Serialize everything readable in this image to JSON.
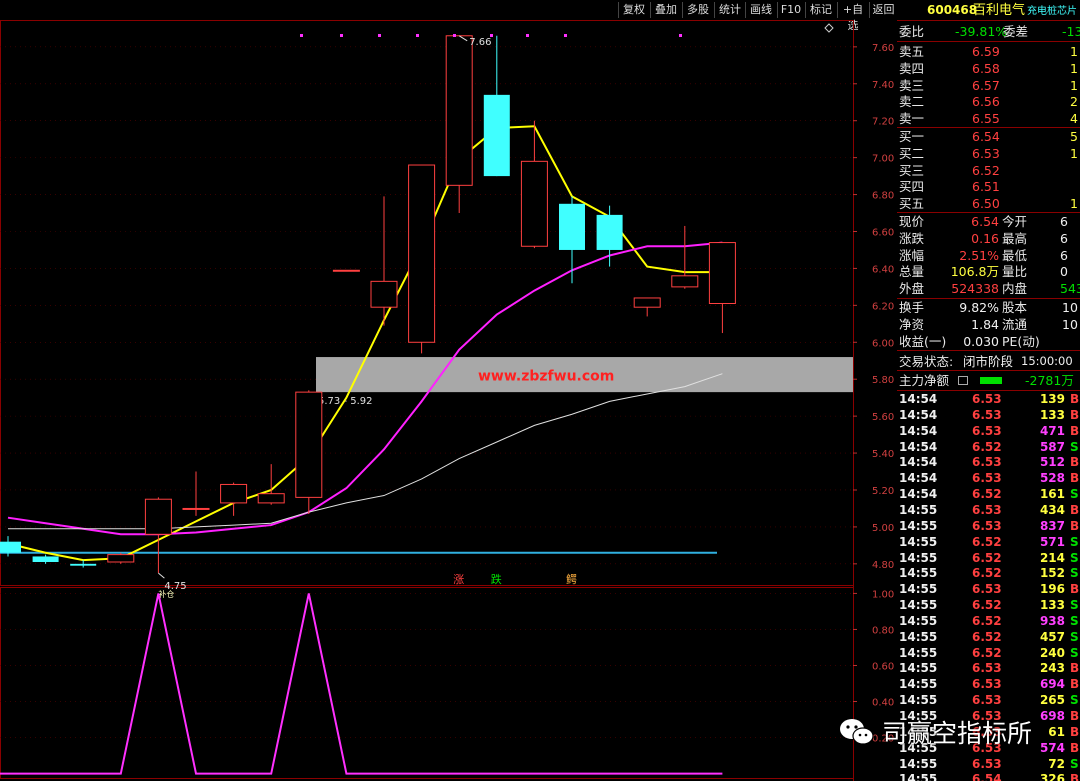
{
  "toolbar": {
    "buttons": [
      "复权",
      "叠加",
      "多股",
      "统计",
      "画线",
      "F10",
      "标记",
      "+自选",
      "返回"
    ]
  },
  "stock": {
    "code": "600468",
    "name": "百利电气",
    "tag": "充电桩芯片"
  },
  "quote": {
    "weibi_label": "委比",
    "weibi_value": "-39.81%",
    "weicha_label": "委差",
    "weicha_value": "-13",
    "asks": [
      {
        "label": "卖五",
        "price": "6.59",
        "vol": "1"
      },
      {
        "label": "卖四",
        "price": "6.58",
        "vol": "1"
      },
      {
        "label": "卖三",
        "price": "6.57",
        "vol": "1"
      },
      {
        "label": "卖二",
        "price": "6.56",
        "vol": "2"
      },
      {
        "label": "卖一",
        "price": "6.55",
        "vol": "4"
      }
    ],
    "bids": [
      {
        "label": "买一",
        "price": "6.54",
        "vol": "5"
      },
      {
        "label": "买二",
        "price": "6.53",
        "vol": "1"
      },
      {
        "label": "买三",
        "price": "6.52",
        "vol": ""
      },
      {
        "label": "买四",
        "price": "6.51",
        "vol": ""
      },
      {
        "label": "买五",
        "price": "6.50",
        "vol": "1"
      }
    ],
    "stats": [
      {
        "l1": "现价",
        "v1": "6.54",
        "l2": "今开",
        "v2": "6"
      },
      {
        "l1": "涨跌",
        "v1": "0.16",
        "l2": "最高",
        "v2": "6"
      },
      {
        "l1": "涨幅",
        "v1": "2.51%",
        "l2": "最低",
        "v2": "6"
      },
      {
        "l1": "总量",
        "v1": "106.8万",
        "l2": "量比",
        "v2": "0"
      },
      {
        "l1": "外盘",
        "v1": "524338",
        "l2": "内盘",
        "v2": "543"
      }
    ],
    "stats2": [
      {
        "l1": "换手",
        "v1": "9.82%",
        "l2": "股本",
        "v2": "10"
      },
      {
        "l1": "净资",
        "v1": "1.84",
        "l2": "流通",
        "v2": "10"
      },
      {
        "l1": "收益(一)",
        "v1": "0.030",
        "l2": "PE(动)",
        "v2": ""
      }
    ],
    "trade_state_label": "交易状态:",
    "trade_state_value": "闭市阶段",
    "trade_time": "15:00:00",
    "main_force_label": "主力净额",
    "main_force_value": "-2781万"
  },
  "ticks": [
    {
      "t": "14:54",
      "p": "6.53",
      "v": "139",
      "d": "B",
      "vc": "yel"
    },
    {
      "t": "14:54",
      "p": "6.53",
      "v": "133",
      "d": "B",
      "vc": "yel"
    },
    {
      "t": "14:54",
      "p": "6.53",
      "v": "471",
      "d": "B",
      "vc": "mag"
    },
    {
      "t": "14:54",
      "p": "6.52",
      "v": "587",
      "d": "S",
      "vc": "mag"
    },
    {
      "t": "14:54",
      "p": "6.53",
      "v": "512",
      "d": "B",
      "vc": "mag"
    },
    {
      "t": "14:54",
      "p": "6.53",
      "v": "528",
      "d": "B",
      "vc": "mag"
    },
    {
      "t": "14:54",
      "p": "6.52",
      "v": "161",
      "d": "S",
      "vc": "yel"
    },
    {
      "t": "14:55",
      "p": "6.53",
      "v": "434",
      "d": "B",
      "vc": "yel"
    },
    {
      "t": "14:55",
      "p": "6.53",
      "v": "837",
      "d": "B",
      "vc": "mag"
    },
    {
      "t": "14:55",
      "p": "6.52",
      "v": "571",
      "d": "S",
      "vc": "mag"
    },
    {
      "t": "14:55",
      "p": "6.52",
      "v": "214",
      "d": "S",
      "vc": "yel"
    },
    {
      "t": "14:55",
      "p": "6.52",
      "v": "152",
      "d": "S",
      "vc": "yel"
    },
    {
      "t": "14:55",
      "p": "6.53",
      "v": "196",
      "d": "B",
      "vc": "yel"
    },
    {
      "t": "14:55",
      "p": "6.52",
      "v": "133",
      "d": "S",
      "vc": "yel"
    },
    {
      "t": "14:55",
      "p": "6.52",
      "v": "938",
      "d": "S",
      "vc": "mag"
    },
    {
      "t": "14:55",
      "p": "6.52",
      "v": "457",
      "d": "S",
      "vc": "yel"
    },
    {
      "t": "14:55",
      "p": "6.52",
      "v": "240",
      "d": "S",
      "vc": "yel"
    },
    {
      "t": "14:55",
      "p": "6.53",
      "v": "243",
      "d": "B",
      "vc": "yel"
    },
    {
      "t": "14:55",
      "p": "6.53",
      "v": "694",
      "d": "B",
      "vc": "mag"
    },
    {
      "t": "14:55",
      "p": "6.53",
      "v": "265",
      "d": "S",
      "vc": "yel"
    },
    {
      "t": "14:55",
      "p": "6.53",
      "v": "698",
      "d": "B",
      "vc": "mag"
    },
    {
      "t": "14:55",
      "p": "6.53",
      "v": "61",
      "d": "B",
      "vc": "yel"
    },
    {
      "t": "14:55",
      "p": "6.53",
      "v": "574",
      "d": "B",
      "vc": "mag"
    },
    {
      "t": "14:55",
      "p": "6.53",
      "v": "72",
      "d": "S",
      "vc": "yel"
    },
    {
      "t": "14:55",
      "p": "6.54",
      "v": "326",
      "d": "B",
      "vc": "yel"
    }
  ],
  "chart_data": [
    {
      "type": "candlestick",
      "y_ticks": [
        7.6,
        7.4,
        7.2,
        7.0,
        6.8,
        6.6,
        6.4,
        6.2,
        6.0,
        5.8,
        5.6,
        5.4,
        5.2,
        5.0,
        4.8
      ],
      "ylim": [
        4.68,
        7.74
      ],
      "candles": [
        {
          "o": 4.92,
          "c": 4.86,
          "h": 4.95,
          "l": 4.84
        },
        {
          "o": 4.84,
          "c": 4.81,
          "h": 4.85,
          "l": 4.8
        },
        {
          "o": 4.8,
          "c": 4.79,
          "h": 4.82,
          "l": 4.78
        },
        {
          "o": 4.81,
          "c": 4.85,
          "h": 4.86,
          "l": 4.8
        },
        {
          "o": 4.96,
          "c": 5.15,
          "h": 5.16,
          "l": 4.75
        },
        {
          "o": 5.1,
          "c": 5.1,
          "h": 5.3,
          "l": 5.06
        },
        {
          "o": 5.13,
          "c": 5.23,
          "h": 5.24,
          "l": 5.06
        },
        {
          "o": 5.13,
          "c": 5.18,
          "h": 5.34,
          "l": 5.12
        },
        {
          "o": 5.16,
          "c": 5.73,
          "h": 5.74,
          "l": 5.07
        },
        {
          "o": 6.39,
          "c": 6.39,
          "h": 6.39,
          "l": 6.39
        },
        {
          "o": 6.19,
          "c": 6.33,
          "h": 6.79,
          "l": 6.09
        },
        {
          "o": 6.0,
          "c": 6.96,
          "h": 6.96,
          "l": 5.94
        },
        {
          "o": 6.85,
          "c": 7.66,
          "h": 7.66,
          "l": 6.7
        },
        {
          "o": 7.34,
          "c": 6.9,
          "h": 7.66,
          "l": 6.9
        },
        {
          "o": 6.52,
          "c": 6.98,
          "h": 7.2,
          "l": 6.51
        },
        {
          "o": 6.75,
          "c": 6.5,
          "h": 6.79,
          "l": 6.32
        },
        {
          "o": 6.69,
          "c": 6.5,
          "h": 6.74,
          "l": 6.41
        },
        {
          "o": 6.19,
          "c": 6.24,
          "h": 6.24,
          "l": 6.14
        },
        {
          "o": 6.3,
          "c": 6.36,
          "h": 6.63,
          "l": 6.29
        },
        {
          "o": 6.21,
          "c": 6.54,
          "h": 6.54,
          "l": 6.05
        }
      ],
      "series": [
        {
          "color": "#ffff00",
          "values": [
            4.91,
            4.86,
            4.82,
            4.83,
            4.93,
            5.03,
            5.13,
            5.2,
            5.38,
            5.7,
            6.12,
            6.52,
            6.99,
            7.16,
            7.17,
            6.79,
            6.68,
            6.41,
            6.38,
            6.38
          ]
        },
        {
          "color": "#ff20ff",
          "values": [
            5.05,
            5.02,
            4.99,
            4.96,
            4.96,
            4.97,
            4.99,
            5.01,
            5.08,
            5.21,
            5.42,
            5.68,
            5.96,
            6.15,
            6.28,
            6.39,
            6.47,
            6.52,
            6.52,
            6.54
          ]
        },
        {
          "color": "#e0e0e0",
          "values": [
            4.99,
            4.99,
            4.99,
            4.99,
            4.99,
            5.0,
            5.01,
            5.02,
            5.08,
            5.13,
            5.17,
            5.26,
            5.37,
            5.46,
            5.55,
            5.61,
            5.68,
            5.72,
            5.76,
            5.83
          ]
        }
      ],
      "support_line": 4.86,
      "zone": [
        5.73,
        5.92
      ],
      "zone_label": "5.73 - 5.92",
      "high_label": "7.66",
      "low_label": "4.75",
      "low_note": "补仓",
      "signals": [
        {
          "text": "涨",
          "color": "#ff4040",
          "index": 12
        },
        {
          "text": "跌",
          "color": "#00e000",
          "index": 13
        },
        {
          "text": "鳄",
          "color": "#ffb040",
          "index": 15
        }
      ],
      "watermark_url": "www.zbzfwu.com"
    },
    {
      "type": "line",
      "y_ticks": [
        1.0,
        0.8,
        0.6,
        0.4,
        0.2
      ],
      "ylim": [
        -0.03,
        1.03
      ],
      "x": [
        0,
        1,
        2,
        3,
        4,
        5,
        6,
        7,
        8,
        9,
        10,
        11,
        12,
        13,
        14,
        15,
        16,
        17,
        18,
        19
      ],
      "values": [
        0,
        0,
        0,
        0,
        1,
        0,
        0,
        0,
        1,
        0,
        0,
        0,
        0,
        0,
        0,
        0,
        0,
        0,
        0,
        0
      ],
      "color": "#ff30ff"
    }
  ],
  "watermark": {
    "text": "司赢空指标所"
  },
  "colors": {
    "up": "#ff4040",
    "down_fill": "#40ffff",
    "grid": "#8a0000",
    "axis_text": "#d04040"
  }
}
